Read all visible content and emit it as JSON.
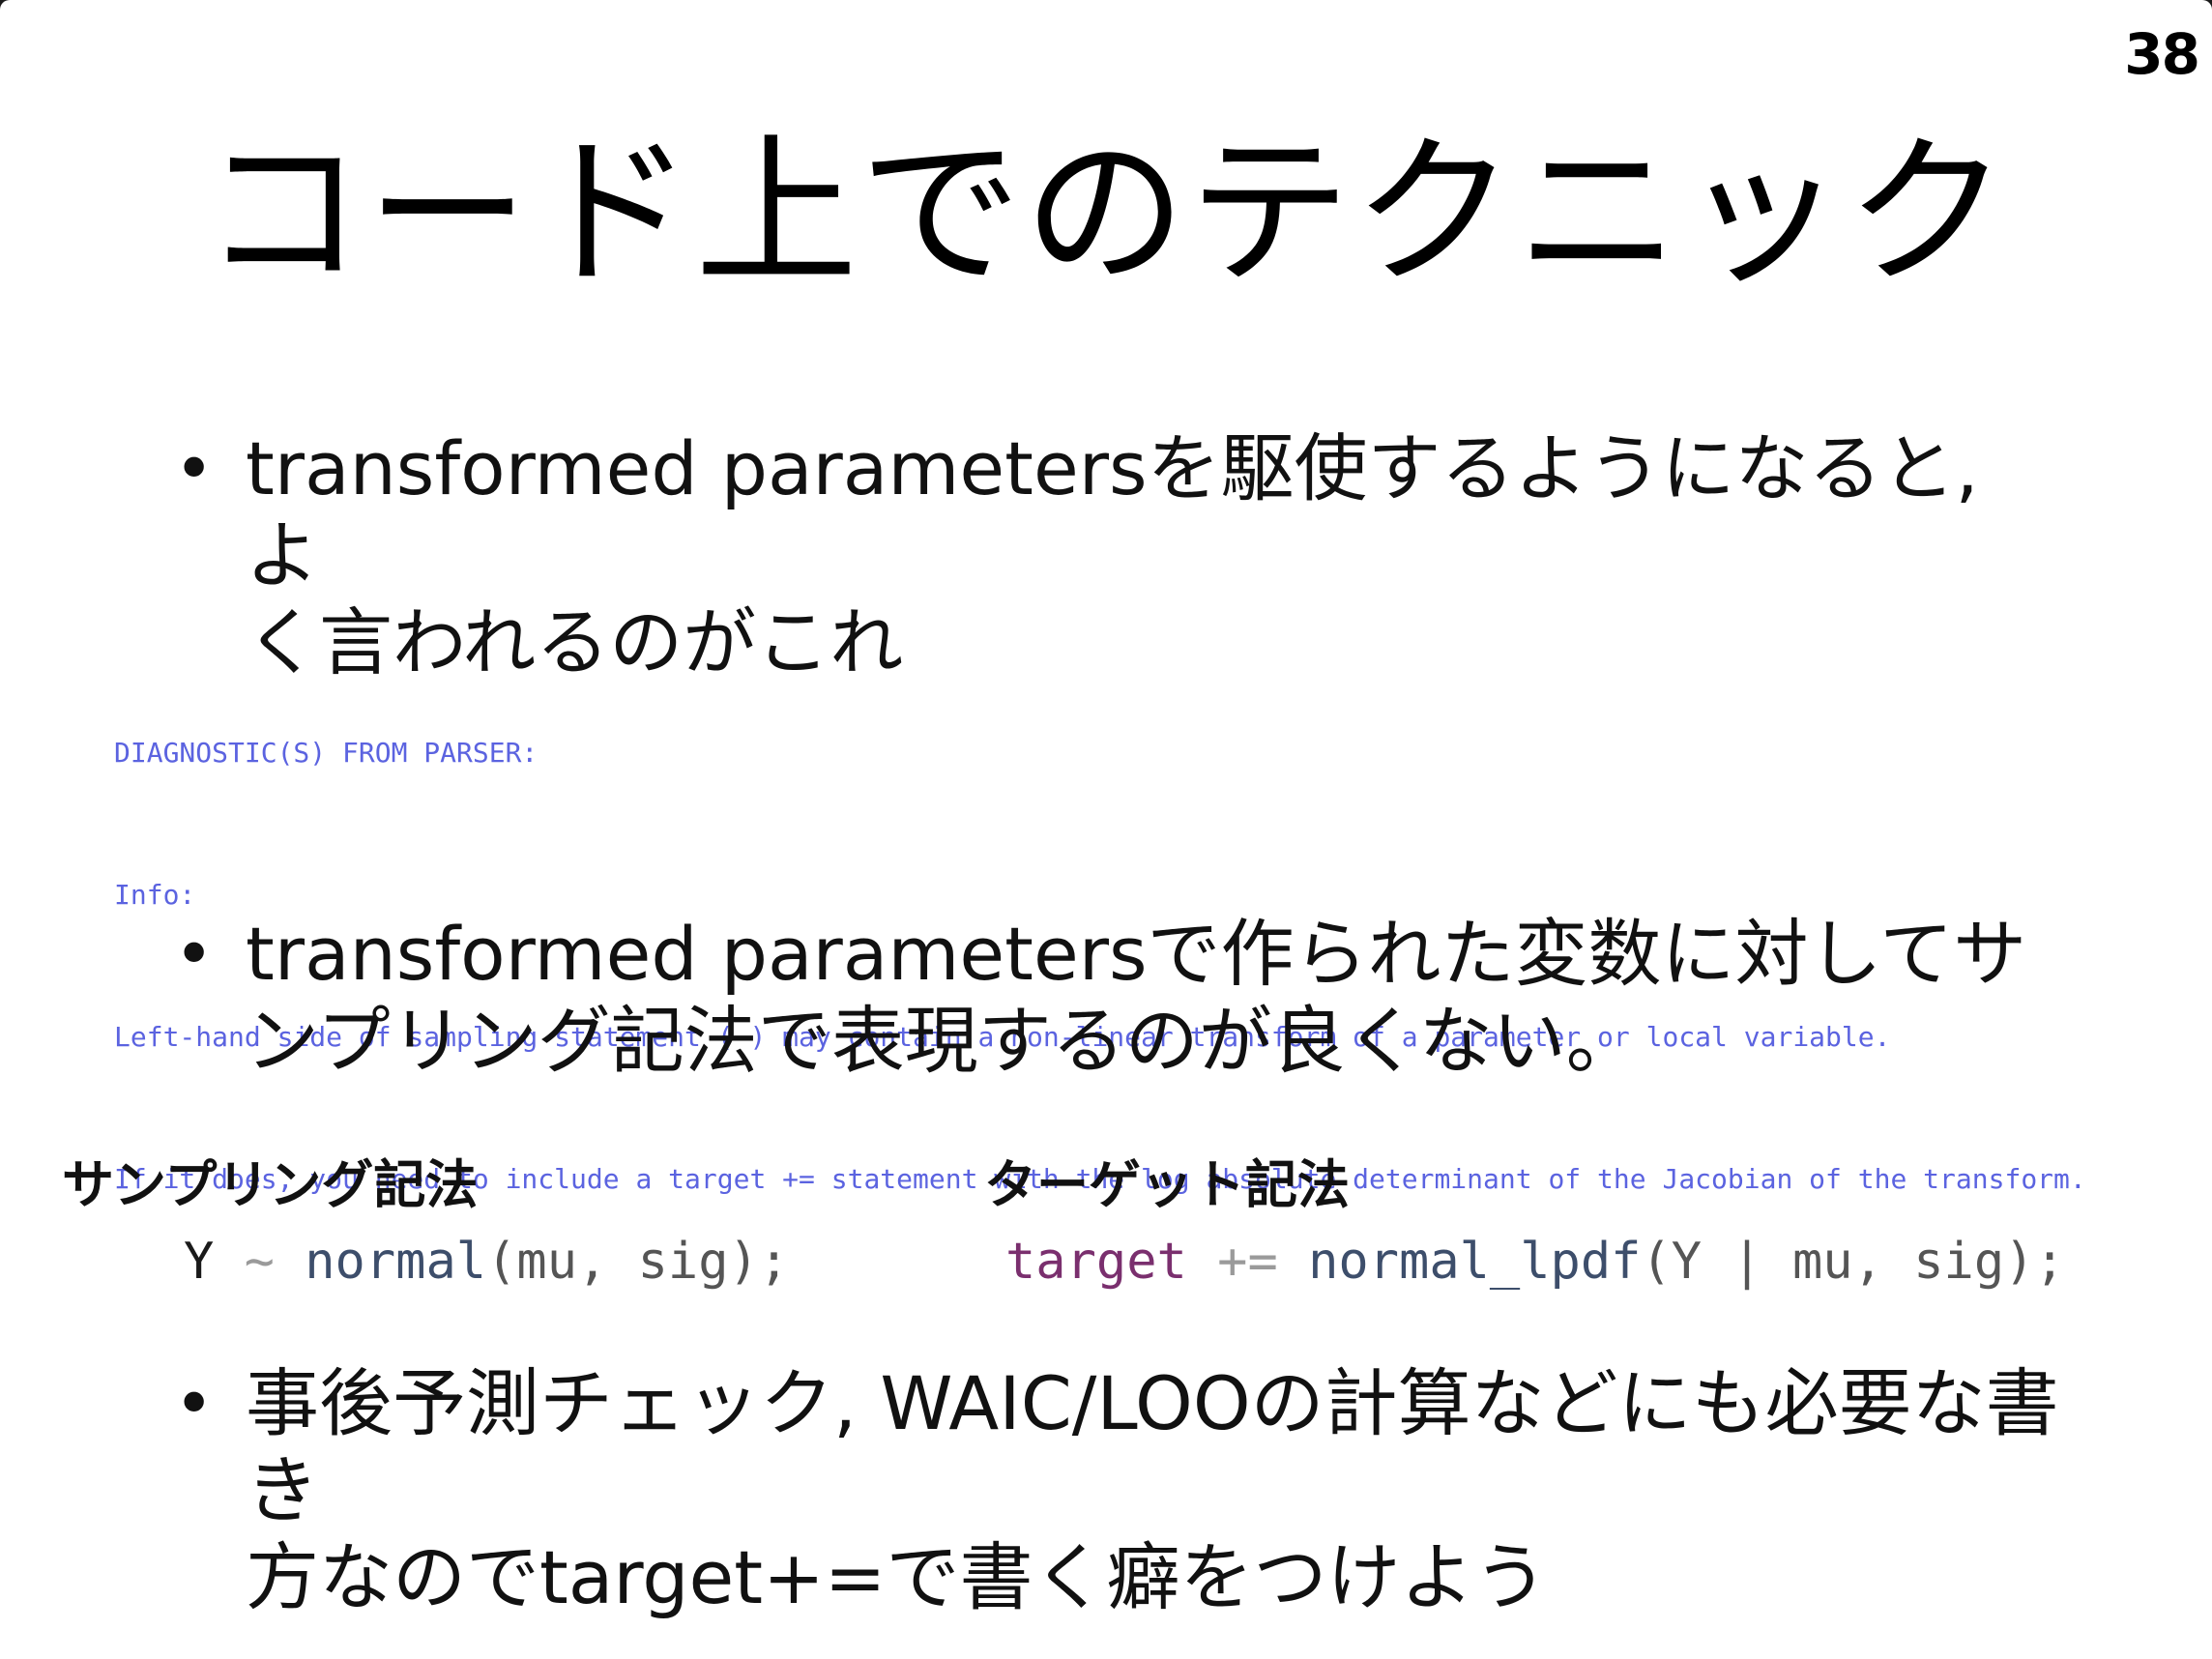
{
  "page_number": "38",
  "title": "コード上でのテクニック",
  "bullets": [
    {
      "marker": "•",
      "text": "transformed parametersを駆使するようになると, よ\nく言われるのがこれ"
    },
    {
      "marker": "•",
      "text": "transformed parametersで作られた変数に対してサ\nンプリング記法で表現するのが良くない。"
    },
    {
      "marker": "•",
      "text": "事後予測チェック, WAIC/LOOの計算などにも必要な書き\n方なのでtarget+=で書く癖をつけよう"
    }
  ],
  "diagnostic": {
    "lines": [
      "DIAGNOSTIC(S) FROM PARSER:",
      "Info:",
      "Left-hand side of sampling statement (~) may contain a non-linear transform of a parameter or local variable.",
      "If it does, you need to include a target += statement with the log absolute determinant of the Jacobian of the transform."
    ]
  },
  "notations": {
    "sampling": {
      "label": "サンプリング記法",
      "code": {
        "var": "Y",
        "op": "~",
        "fn": "normal",
        "args": "(mu, sig);"
      }
    },
    "target": {
      "label": "ターゲット記法",
      "code": {
        "kw": "target",
        "op": "+=",
        "fn": "normal_lpdf",
        "args": "(Y | mu, sig);"
      }
    }
  },
  "colors": {
    "diagnostic_text": "#5b63e0",
    "keyword_target": "#7a2f6e",
    "function_name": "#3d4e6b"
  }
}
